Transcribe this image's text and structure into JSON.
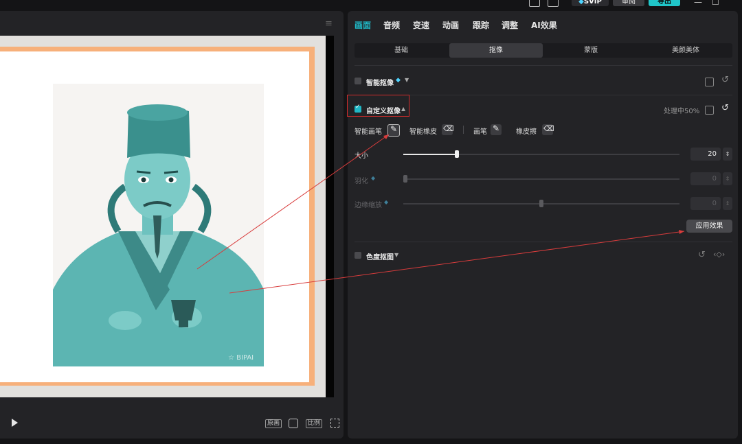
{
  "titlebar": {
    "svip": "SVIP",
    "review": "审阅",
    "export": "导出",
    "win_min": "—",
    "win_max": "☐"
  },
  "player": {
    "ctrl_original": "原画",
    "ctrl_ratio": "比例",
    "menu_icon": "hamburger-icon"
  },
  "panel": {
    "tabs": [
      "画面",
      "音频",
      "变速",
      "动画",
      "跟踪",
      "调整",
      "AI效果"
    ],
    "active_tab": 0,
    "subtabs": [
      "基础",
      "抠像",
      "蒙版",
      "美颜美体"
    ],
    "active_subtab": 1,
    "smart_cutout": {
      "label": "智能抠像",
      "checked": false
    },
    "custom_cutout": {
      "label": "自定义抠像",
      "checked": true,
      "status": "处理中50%"
    },
    "tools": {
      "smart_brush": "智能画笔",
      "smart_eraser": "智能橡皮",
      "brush": "画笔",
      "eraser": "橡皮擦"
    },
    "size": {
      "label": "大小",
      "value": "20",
      "level": 0.2
    },
    "feather": {
      "label": "羽化",
      "value": "0",
      "level": 0
    },
    "edge_scale": {
      "label": "边缘缩放",
      "value": "0",
      "level": 0.5
    },
    "apply_button": "应用效果",
    "chroma_key": {
      "label": "色度抠图",
      "checked": false
    }
  },
  "colors": {
    "accent": "#1fb8c6",
    "highlight_box": "#d42c2c",
    "annotation_line": "#d83c3c",
    "frame": "#f7b07a"
  }
}
